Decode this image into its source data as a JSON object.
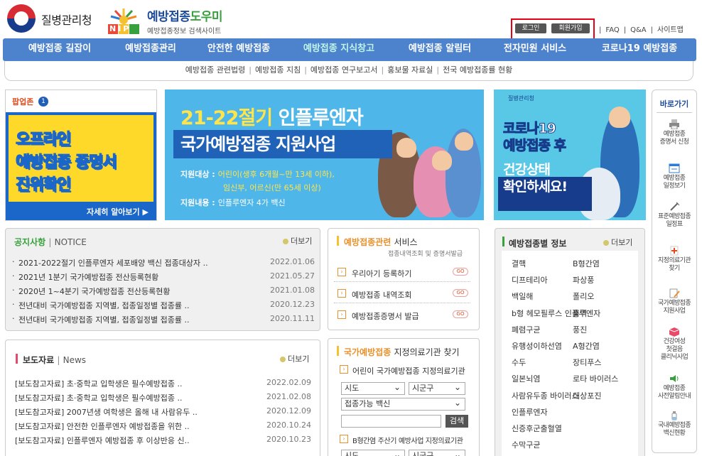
{
  "header": {
    "agency": "질병관리청",
    "nip": "NIP",
    "site_main": "예방접종",
    "site_accent": "도우미",
    "site_sub": "예방접종정보 검색사이트",
    "login": "로그인",
    "signup": "회원가입",
    "links": [
      "FAQ",
      "Q&A",
      "사이트맵"
    ]
  },
  "nav": {
    "items": [
      "예방접종 길잡이",
      "예방접종관리",
      "안전한 예방접종",
      "예방접종 지식창고",
      "예방접종 알림터",
      "전자민원 서비스",
      "코로나19 예방접종"
    ],
    "sub": [
      "예방접종 관련법령",
      "예방접종 지침",
      "예방접종 연구보고서",
      "홍보물 자료실",
      "전국 예방접종률 현황"
    ]
  },
  "popup": {
    "title": "팝업존",
    "num": "1",
    "lines": [
      "오프라인",
      "예방접종 증명서",
      "진위확인"
    ],
    "more": "자세히 알아보기 ▶"
  },
  "banner1": {
    "title_y": "21-22절기",
    "title_w": "인플루엔자",
    "subtitle": "국가예방접종 지원사업",
    "target_label": "지원대상 :",
    "target_1": "어린이(생후 6개월~만 13세 이하),",
    "target_2": "임신부, 어르신(만 65세 이상)",
    "content_label": "지원내용 :",
    "content": "인플루엔자 4가 백신"
  },
  "banner2": {
    "agency": "질병관리청",
    "lines": [
      "코로나19",
      "예방접종 후",
      "건강상태",
      "확인하세요!"
    ]
  },
  "quick": {
    "title": "바로가기",
    "items": [
      [
        "예방접종",
        "증명서 신청"
      ],
      [
        "예방접종",
        "일정보기"
      ],
      [
        "표준예방접종",
        "일정표"
      ],
      [
        "지정의료기관",
        "찾기"
      ],
      [
        "국가예방접종",
        "지원사업"
      ],
      [
        "건강여성",
        "첫걸음",
        "클리닉사업"
      ],
      [
        "예방접종",
        "사전알림안내"
      ],
      [
        "국내예방접종",
        "백신현황"
      ]
    ]
  },
  "notice": {
    "title": "공지사항",
    "title_en": "NOTICE",
    "more": "더보기",
    "items": [
      {
        "t": "2021-2022절기 인플루엔자 세포배양 백신 접종대상자 ..",
        "d": "2022.01.06"
      },
      {
        "t": "2021년 1분기 국가예방접종 전산등록현황",
        "d": "2021.05.27"
      },
      {
        "t": "2020년 1~4분기 국가예방접종 전산등록현황",
        "d": "2021.01.08"
      },
      {
        "t": "전년대비 국가예방접종 지역별, 접종일정별 접종률 ..",
        "d": "2020.12.23"
      },
      {
        "t": "전년대비 국가예방접종 지역별, 접종일정별 접종률 ..",
        "d": "2020.11.11"
      }
    ]
  },
  "press": {
    "title": "보도자료",
    "title_en": "News",
    "more": "더보기",
    "items": [
      {
        "t": "[보도참고자료] 초·중학교 입학생은 필수예방접종 ..",
        "d": "2022.02.09"
      },
      {
        "t": "[보도참고자료] 초·중학교 입학생은 필수예방접종 ..",
        "d": "2021.02.08"
      },
      {
        "t": "[보도참고자료] 2007년생 여학생은 올해 내 사람유두 ..",
        "d": "2020.12.09"
      },
      {
        "t": "[보도참고자료] 안전한 인플루엔자 예방접종을 위한 ..",
        "d": "2020.10.24"
      },
      {
        "t": "[보도참고자료] 인플루엔자 예방접종 후 이상반응 신..",
        "d": "2020.10.23"
      }
    ]
  },
  "services": {
    "title": "예방접종관련",
    "title_rest": "서비스",
    "desc": "접종내역조회 및 증명서발급",
    "items": [
      "우리아기 등록하기",
      "예방접종 내역조회",
      "예방접종증명서 발급"
    ],
    "go": "GO"
  },
  "clinic": {
    "title": "국가예방접종",
    "title_rest": "지정의료기관 찾기",
    "sub1": "어린이 국가예방접종 지정의료기관",
    "sido": "시도",
    "sigungu": "시군구",
    "vaccine": "접종가능 백신",
    "search": "검색",
    "sub2": "B형간염 주산기 예방사업 지정의료기관"
  },
  "disease": {
    "title": "예방접종별 정보",
    "more": "더보기",
    "left": [
      "결핵",
      "디프테리아",
      "백일해",
      "b형 헤모필루스 인플루엔자",
      "폐렴구균",
      "유행성이하선염",
      "수두",
      "일본뇌염",
      "사람유두종 바이러스",
      "인플루엔자",
      "신증후군출혈열",
      "수막구균"
    ],
    "right": [
      "B형간염",
      "파상풍",
      "폴리오",
      "홍역",
      "풍진",
      "A형간염",
      "장티푸스",
      "로타 바이러스",
      "대상포진"
    ]
  }
}
